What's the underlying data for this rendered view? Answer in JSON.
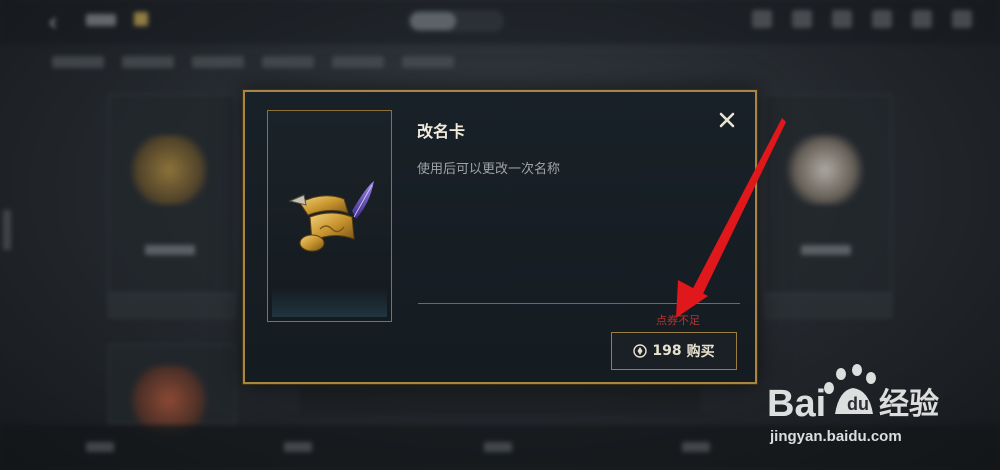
{
  "dialog": {
    "title": "改名卡",
    "description": "使用后可以更改一次名称",
    "warning": "点券不足",
    "price": "198",
    "buy_label": "购买",
    "close_icon": "close-icon",
    "currency_icon": "coupon-coin-icon"
  },
  "watermark": {
    "brand": "Baidu经验",
    "url": "jingyan.baidu.com"
  },
  "colors": {
    "gold_border": "#a7873f",
    "warning_red": "#b8342e",
    "dialog_bg": "#161d23"
  }
}
